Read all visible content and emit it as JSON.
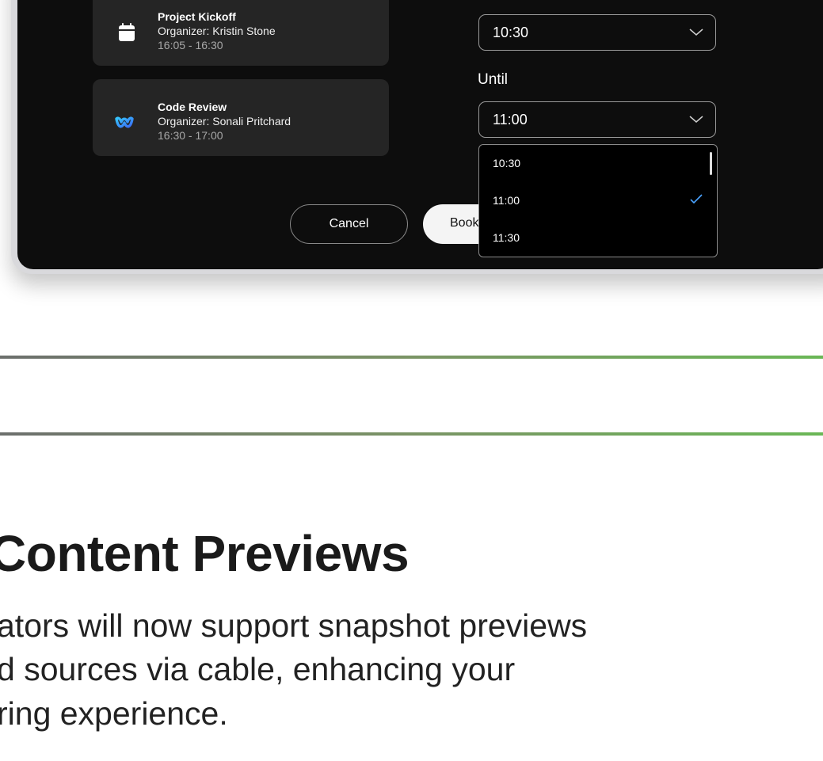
{
  "meetings": [
    {
      "title": "Project Kickoff",
      "organizer": "Organizer: Kristin Stone",
      "time": "16:05 - 16:30",
      "icon": "calendar-icon"
    },
    {
      "title": "Code Review",
      "organizer": "Organizer: Sonali Pritchard",
      "time": "16:30 - 17:00",
      "icon": "webex-icon"
    }
  ],
  "from_select": {
    "value": "10:30"
  },
  "until": {
    "label": "Until",
    "value": "11:00"
  },
  "dropdown": {
    "options": [
      "10:30",
      "11:00",
      "11:30"
    ],
    "selected": "11:00"
  },
  "buttons": {
    "cancel": "Cancel",
    "book": "Book"
  },
  "article": {
    "heading": "Content Previews",
    "lines": [
      "ators will now support snapshot previews",
      "d sources via cable, enhancing your",
      "ring experience."
    ]
  },
  "colors": {
    "accent_check": "#4aa3ff",
    "rule_green": "#6ab756"
  }
}
